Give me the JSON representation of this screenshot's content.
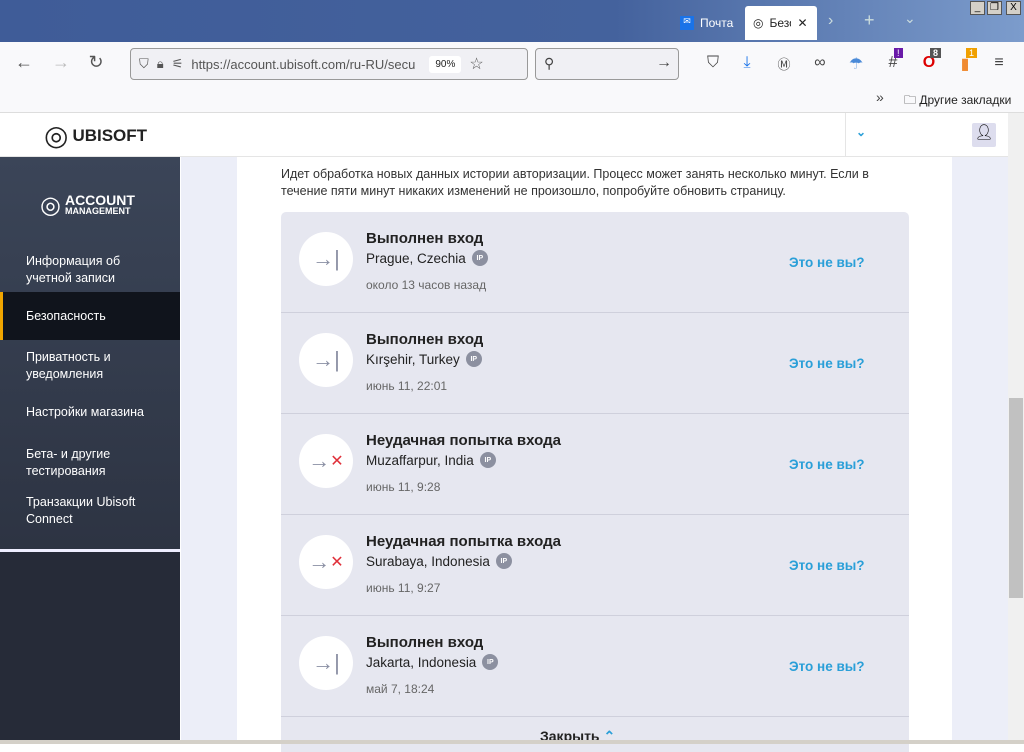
{
  "browser": {
    "tabs": [
      {
        "label": "Почта"
      },
      {
        "label": "Безо"
      }
    ],
    "url": "https://account.ubisoft.com/ru-RU/secu",
    "zoom": "90%",
    "bookmarks_folder": "Другие закладки",
    "badges": {
      "ext1": "!",
      "ext2": "8",
      "ext3": "1"
    }
  },
  "header": {
    "logo": "UBISOFT"
  },
  "sidebar": {
    "logo_line1": "ACCOUNT",
    "logo_line2": "MANAGEMENT",
    "items": [
      {
        "label": "Информация об учетной записи"
      },
      {
        "label": "Безопасность",
        "active": true
      },
      {
        "label": "Приватность и уведомления"
      },
      {
        "label": "Настройки магазина"
      },
      {
        "label": "Бета- и другие тестирования"
      },
      {
        "label": "Транзакции Ubisoft Connect"
      }
    ]
  },
  "main": {
    "notice": "Идет обработка новых данных истории авторизации. Процесс может занять несколько минут. Если в течение пяти минут никаких изменений не произошло, попробуйте обновить страницу.",
    "ip_label": "IP",
    "not_me": "Это не вы?",
    "events": [
      {
        "title": "Выполнен вход",
        "location": "Prague, Czechia",
        "time": "около 13 часов назад",
        "status": "success"
      },
      {
        "title": "Выполнен вход",
        "location": "Kırşehir, Turkey",
        "time": "июнь 11, 22:01",
        "status": "success"
      },
      {
        "title": "Неудачная попытка входа",
        "location": "Muzaffarpur, India",
        "time": "июнь 11, 9:28",
        "status": "failed"
      },
      {
        "title": "Неудачная попытка входа",
        "location": "Surabaya, Indonesia",
        "time": "июнь 11, 9:27",
        "status": "failed"
      },
      {
        "title": "Выполнен вход",
        "location": "Jakarta, Indonesia",
        "time": "май 7, 18:24",
        "status": "success"
      }
    ],
    "close_label": "Закрыть"
  }
}
